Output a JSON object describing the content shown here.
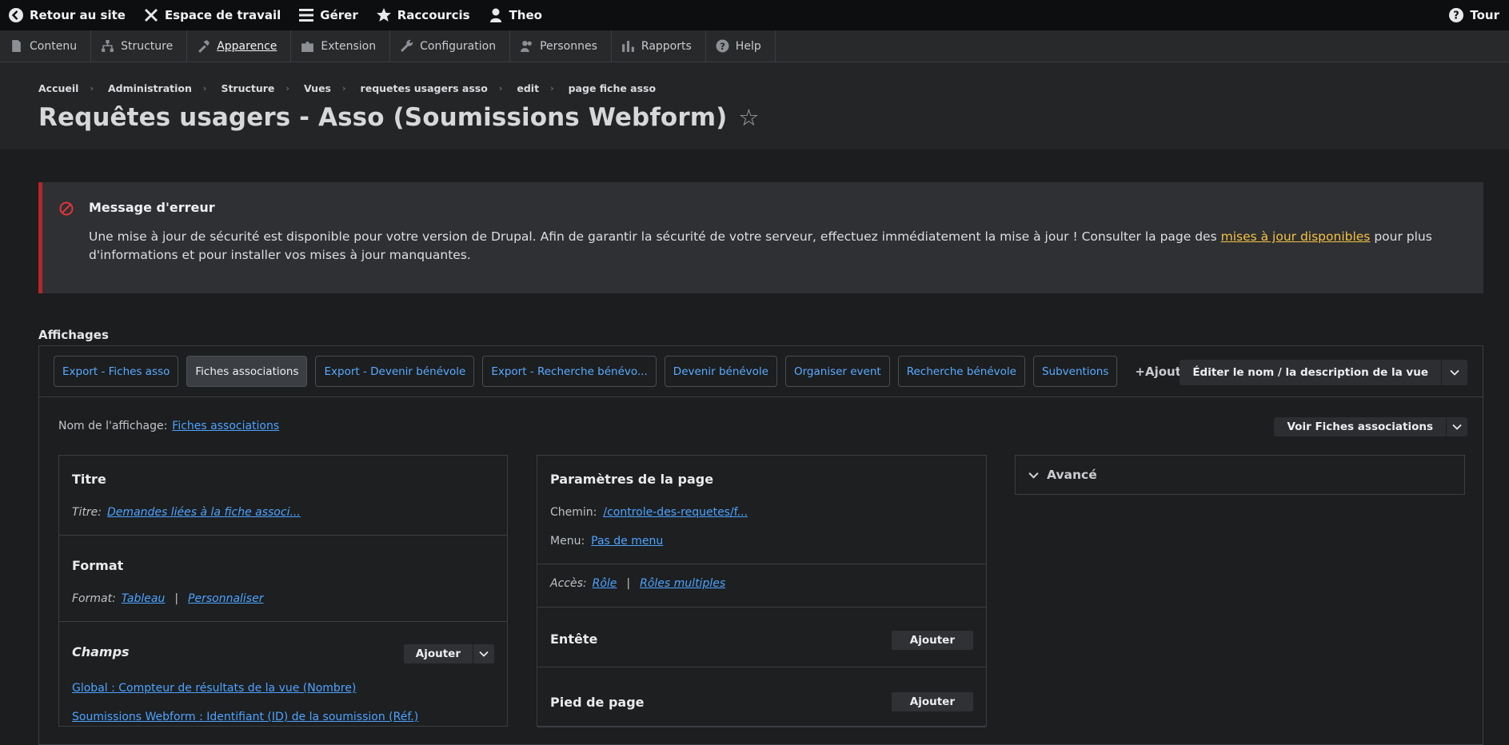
{
  "toolbar": {
    "back": "Retour au site",
    "workspace": "Espace de travail",
    "manage": "Gérer",
    "shortcuts": "Raccourcis",
    "user": "Theo",
    "tour": "Tour"
  },
  "tray": {
    "items": [
      "Contenu",
      "Structure",
      "Apparence",
      "Extension",
      "Configuration",
      "Personnes",
      "Rapports",
      "Help"
    ]
  },
  "breadcrumb": [
    "Accueil",
    "Administration",
    "Structure",
    "Vues",
    "requetes usagers asso",
    "edit",
    "page fiche asso"
  ],
  "page_title": "Requêtes usagers - Asso (Soumissions Webform)",
  "message": {
    "title": "Message d'erreur",
    "body_before": "Une mise à jour de sécurité est disponible pour votre version de Drupal. Afin de garantir la sécurité de votre serveur, effectuez immédiatement la mise à jour ! Consulter la page des ",
    "link": "mises à jour disponibles",
    "body_after": " pour plus d'informations et pour installer vos mises à jour manquantes."
  },
  "displays": {
    "label": "Affichages",
    "tabs": [
      "Export - Fiches asso",
      "Fiches associations",
      "Export - Devenir bénévole",
      "Export - Recherche bénévo...",
      "Devenir bénévole",
      "Organiser event",
      "Recherche bénévole",
      "Subventions"
    ],
    "active_tab": "Fiches associations",
    "add": "Ajouter",
    "edit_name": "Éditer le nom / la description de la vue",
    "display_name_label": "Nom de l'affichage:",
    "display_name_value": "Fiches associations",
    "view_button": "Voir Fiches associations"
  },
  "col1": {
    "title_section": "Titre",
    "title_label": "Titre:",
    "title_value": "Demandes liées à la fiche associ...",
    "format_section": "Format",
    "format_label": "Format:",
    "format_value": "Tableau",
    "format_custom": "Personnaliser",
    "fields_section": "Champs",
    "fields_add": "Ajouter",
    "fields": [
      "Global : Compteur de résultats de la vue (Nombre)",
      "Soumissions Webform : Identifiant (ID) de la soumission (Réf.)"
    ]
  },
  "col2": {
    "page_section": "Paramètres de la page",
    "path_label": "Chemin:",
    "path_value": "/controle-des-requetes/f...",
    "menu_label": "Menu:",
    "menu_value": "Pas de menu",
    "access_label": "Accès:",
    "access_value": "Rôle",
    "access_multi": "Rôles multiples",
    "header_section": "Entête",
    "header_add": "Ajouter",
    "footer_section": "Pied de page",
    "footer_add": "Ajouter"
  },
  "col3": {
    "advanced": "Avancé"
  }
}
